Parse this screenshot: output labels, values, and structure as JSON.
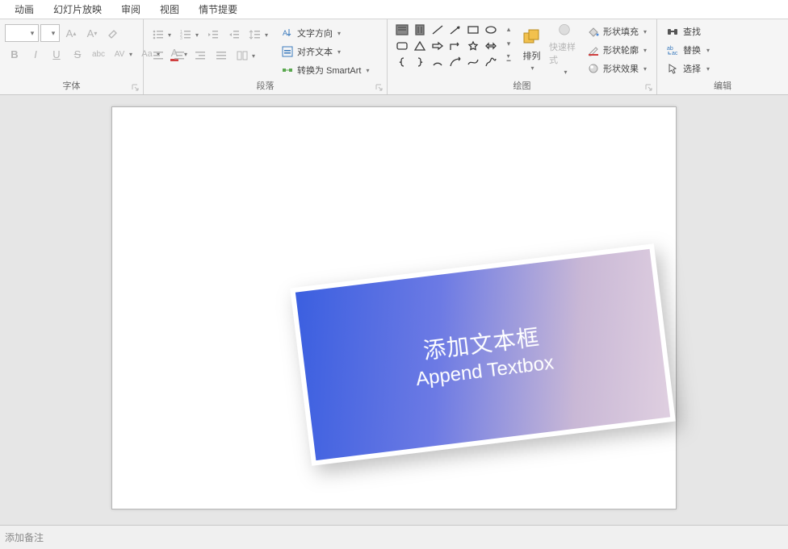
{
  "menu": [
    "动画",
    "幻灯片放映",
    "审阅",
    "视图",
    "情节提要"
  ],
  "ribbon": {
    "font": {
      "label": "字体",
      "grow": "A",
      "shrink": "A",
      "bold": "B",
      "italic": "I",
      "underline": "U",
      "strike": "S",
      "shadow": "abc",
      "spacing": "AV",
      "case": "Aa",
      "color": "A"
    },
    "para": {
      "label": "段落",
      "text_dir": "文字方向",
      "align_text": "对齐文本",
      "smartart": "转换为 SmartArt"
    },
    "draw": {
      "label": "绘图",
      "arrange": "排列",
      "quick": "快速样式",
      "fill": "形状填充",
      "outline": "形状轮廓",
      "effects": "形状效果"
    },
    "edit": {
      "label": "编辑",
      "find": "查找",
      "replace": "替换",
      "select": "选择"
    }
  },
  "slide": {
    "line1": "添加文本框",
    "line2": "Append Textbox"
  },
  "notes_placeholder": "添加备注"
}
